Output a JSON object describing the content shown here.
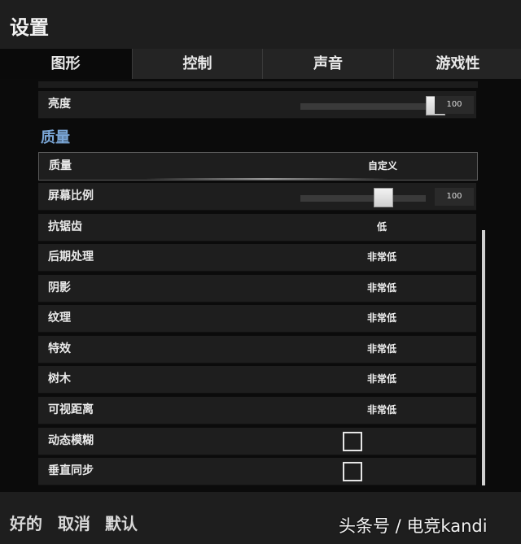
{
  "window": {
    "title": "设置"
  },
  "tabs": [
    {
      "label": "图形",
      "active": true
    },
    {
      "label": "控制",
      "active": false
    },
    {
      "label": "声音",
      "active": false
    },
    {
      "label": "游戏性",
      "active": false
    }
  ],
  "brightness": {
    "label": "亮度",
    "value": "100",
    "slider_fraction": 0.98
  },
  "quality_section": {
    "title": "质量"
  },
  "settings": [
    {
      "label": "质量",
      "value": "自定义"
    },
    {
      "label": "屏幕比例",
      "value": "100",
      "slider_fraction": 0.62
    },
    {
      "label": "抗锯齿",
      "value": "低"
    },
    {
      "label": "后期处理",
      "value": "非常低"
    },
    {
      "label": "阴影",
      "value": "非常低"
    },
    {
      "label": "纹理",
      "value": "非常低"
    },
    {
      "label": "特效",
      "value": "非常低"
    },
    {
      "label": "树木",
      "value": "非常低"
    },
    {
      "label": "可视距离",
      "value": "非常低"
    },
    {
      "label": "动态模糊",
      "checked": false
    },
    {
      "label": "垂直同步",
      "checked": false
    }
  ],
  "footer": {
    "ok": "好的",
    "cancel": "取消",
    "default": "默认"
  },
  "watermark": "头条号 / 电竞kandi",
  "colors": {
    "section_title": "#7aa6d6",
    "background": "#0b0b0b",
    "row": "#1e1e1e"
  }
}
